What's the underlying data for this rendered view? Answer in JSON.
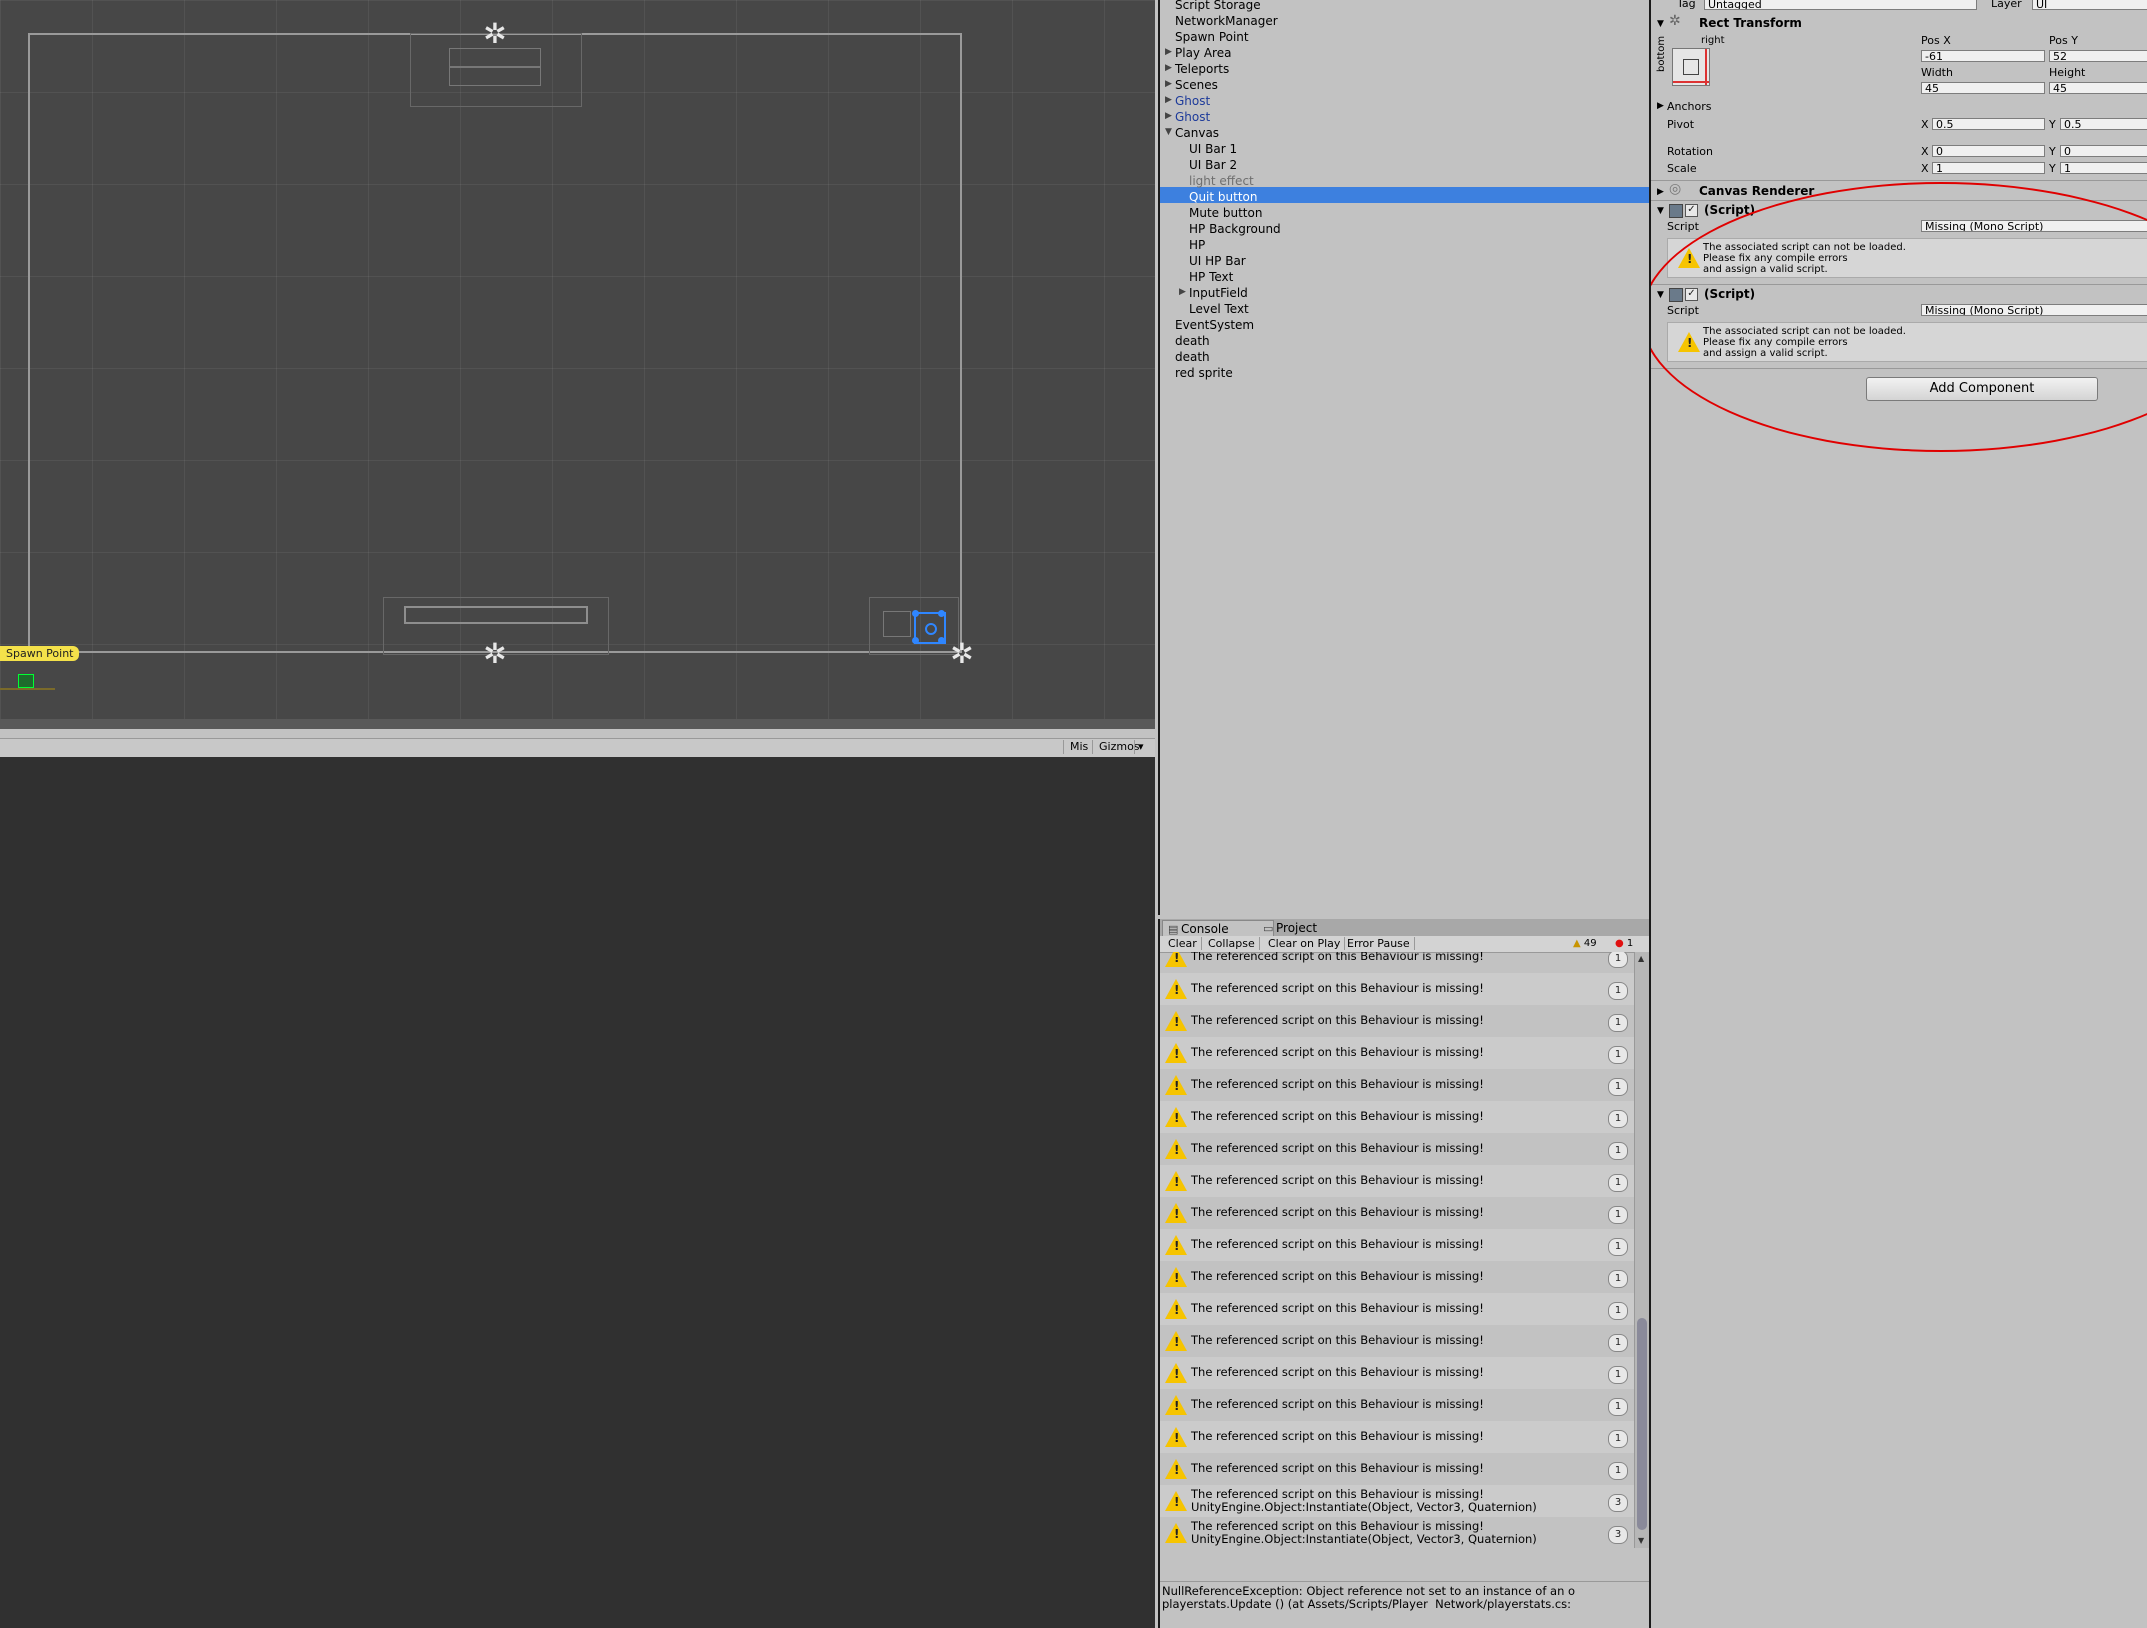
{
  "scene": {
    "spawn_point_label": "Spawn Point",
    "toolbar": {
      "mis": "Mis",
      "gizmos": "Gizmos",
      "gizmos_arrow": "▾"
    }
  },
  "hierarchy": {
    "selected_index": 12,
    "items": [
      {
        "label": "Script Storage",
        "depth": 0,
        "arrow": "",
        "style": "normal"
      },
      {
        "label": "NetworkManager",
        "depth": 0,
        "arrow": "",
        "style": "normal"
      },
      {
        "label": "Spawn Point",
        "depth": 0,
        "arrow": "",
        "style": "normal"
      },
      {
        "label": "Play Area",
        "depth": 0,
        "arrow": "▶",
        "style": "normal"
      },
      {
        "label": "Teleports",
        "depth": 0,
        "arrow": "▶",
        "style": "normal"
      },
      {
        "label": "Scenes",
        "depth": 0,
        "arrow": "▶",
        "style": "normal"
      },
      {
        "label": "Ghost",
        "depth": 0,
        "arrow": "▶",
        "style": "blue"
      },
      {
        "label": "Ghost",
        "depth": 0,
        "arrow": "▶",
        "style": "blue"
      },
      {
        "label": "Canvas",
        "depth": 0,
        "arrow": "▼",
        "style": "normal"
      },
      {
        "label": "UI Bar 1",
        "depth": 1,
        "arrow": "",
        "style": "normal"
      },
      {
        "label": "UI Bar 2",
        "depth": 1,
        "arrow": "",
        "style": "normal"
      },
      {
        "label": "light effect",
        "depth": 1,
        "arrow": "",
        "style": "gray"
      },
      {
        "label": "Quit button",
        "depth": 1,
        "arrow": "",
        "style": "selected"
      },
      {
        "label": "Mute button",
        "depth": 1,
        "arrow": "",
        "style": "normal"
      },
      {
        "label": "HP Background",
        "depth": 1,
        "arrow": "",
        "style": "normal"
      },
      {
        "label": "HP",
        "depth": 1,
        "arrow": "",
        "style": "normal"
      },
      {
        "label": "UI HP Bar",
        "depth": 1,
        "arrow": "",
        "style": "normal"
      },
      {
        "label": "HP Text",
        "depth": 1,
        "arrow": "",
        "style": "normal"
      },
      {
        "label": "InputField",
        "depth": 1,
        "arrow": "▶",
        "style": "normal"
      },
      {
        "label": "Level Text",
        "depth": 1,
        "arrow": "",
        "style": "normal"
      },
      {
        "label": "EventSystem",
        "depth": 0,
        "arrow": "",
        "style": "normal"
      },
      {
        "label": "death",
        "depth": 0,
        "arrow": "",
        "style": "normal"
      },
      {
        "label": "death",
        "depth": 0,
        "arrow": "",
        "style": "normal"
      },
      {
        "label": "red sprite",
        "depth": 0,
        "arrow": "",
        "style": "normal"
      }
    ]
  },
  "inspector": {
    "tag_label": "Tag",
    "tag_value": "Untagged",
    "layer_label": "Layer",
    "layer_value": "UI",
    "rect_transform": {
      "title": "Rect Transform",
      "anchor_top_label": "right",
      "anchor_side_label": "bottom",
      "pos_x_label": "Pos X",
      "pos_y_label": "Pos Y",
      "pos_x": "-61",
      "pos_y": "52",
      "width_label": "Width",
      "height_label": "Height",
      "width": "45",
      "height": "45",
      "anchors_label": "Anchors",
      "pivot_label": "Pivot",
      "pivot_x": "0.5",
      "pivot_y": "0.5",
      "rotation_label": "Rotation",
      "rotation_x": "0",
      "rotation_y": "0",
      "scale_label": "Scale",
      "scale_x": "1",
      "scale_y": "1",
      "x_label": "X",
      "y_label": "Y"
    },
    "canvas_renderer": {
      "title": "Canvas Renderer"
    },
    "script_components": [
      {
        "title": "(Script)",
        "script_label": "Script",
        "script_value": "Missing (Mono Script)",
        "warning": "The associated script can not be loaded.\nPlease fix any compile errors\nand assign a valid script."
      },
      {
        "title": "(Script)",
        "script_label": "Script",
        "script_value": "Missing (Mono Script)",
        "warning": "The associated script can not be loaded.\nPlease fix any compile errors\nand assign a valid script."
      }
    ],
    "add_component_label": "Add Component",
    "annotation_color": "#e00000"
  },
  "console": {
    "tabs": [
      {
        "label": "Console",
        "active": true
      },
      {
        "label": "Project",
        "active": false
      }
    ],
    "toolbar": {
      "clear": "Clear",
      "collapse": "Collapse",
      "clear_on_play": "Clear on Play",
      "error_pause": "Error Pause",
      "warning_count": "49",
      "error_count": "1"
    },
    "entries": [
      {
        "type": "warning",
        "line1": "The referenced script on this Behaviour is missing!",
        "line2": "",
        "count": "1"
      },
      {
        "type": "warning",
        "line1": "The referenced script on this Behaviour is missing!",
        "line2": "",
        "count": "1"
      },
      {
        "type": "warning",
        "line1": "The referenced script on this Behaviour is missing!",
        "line2": "",
        "count": "1"
      },
      {
        "type": "warning",
        "line1": "The referenced script on this Behaviour is missing!",
        "line2": "",
        "count": "1"
      },
      {
        "type": "warning",
        "line1": "The referenced script on this Behaviour is missing!",
        "line2": "",
        "count": "1"
      },
      {
        "type": "warning",
        "line1": "The referenced script on this Behaviour is missing!",
        "line2": "",
        "count": "1"
      },
      {
        "type": "warning",
        "line1": "The referenced script on this Behaviour is missing!",
        "line2": "",
        "count": "1"
      },
      {
        "type": "warning",
        "line1": "The referenced script on this Behaviour is missing!",
        "line2": "",
        "count": "1"
      },
      {
        "type": "warning",
        "line1": "The referenced script on this Behaviour is missing!",
        "line2": "",
        "count": "1"
      },
      {
        "type": "warning",
        "line1": "The referenced script on this Behaviour is missing!",
        "line2": "",
        "count": "1"
      },
      {
        "type": "warning",
        "line1": "The referenced script on this Behaviour is missing!",
        "line2": "",
        "count": "1"
      },
      {
        "type": "warning",
        "line1": "The referenced script on this Behaviour is missing!",
        "line2": "",
        "count": "1"
      },
      {
        "type": "warning",
        "line1": "The referenced script on this Behaviour is missing!",
        "line2": "",
        "count": "1"
      },
      {
        "type": "warning",
        "line1": "The referenced script on this Behaviour is missing!",
        "line2": "",
        "count": "1"
      },
      {
        "type": "warning",
        "line1": "The referenced script on this Behaviour is missing!",
        "line2": "",
        "count": "1"
      },
      {
        "type": "warning",
        "line1": "The referenced script on this Behaviour is missing!",
        "line2": "",
        "count": "1"
      },
      {
        "type": "warning",
        "line1": "The referenced script on this Behaviour is missing!",
        "line2": "",
        "count": "1"
      },
      {
        "type": "warning",
        "line1": "The referenced script on this Behaviour is missing!",
        "line2": "UnityEngine.Object:Instantiate(Object, Vector3, Quaternion)",
        "count": "3"
      },
      {
        "type": "warning",
        "line1": "The referenced script on this Behaviour is missing!",
        "line2": "UnityEngine.Object:Instantiate(Object, Vector3, Quaternion)",
        "count": "3"
      },
      {
        "type": "warning",
        "line1": "The referenced script on this Behaviour is missing!",
        "line2": "UnityEngine.Object:Instantiate(Object, Vector3, Quaternion)",
        "count": "3"
      },
      {
        "type": "error",
        "line1": "NullReferenceException: Object reference not set to an instance of",
        "line2": "playerstats.Update () (at Assets/Scripts/Player  Network/playersta",
        "count": "1",
        "selected": true
      }
    ],
    "detail": "NullReferenceException: Object reference not set to an instance of an o\nplayerstats.Update () (at Assets/Scripts/Player  Network/playerstats.cs:"
  }
}
